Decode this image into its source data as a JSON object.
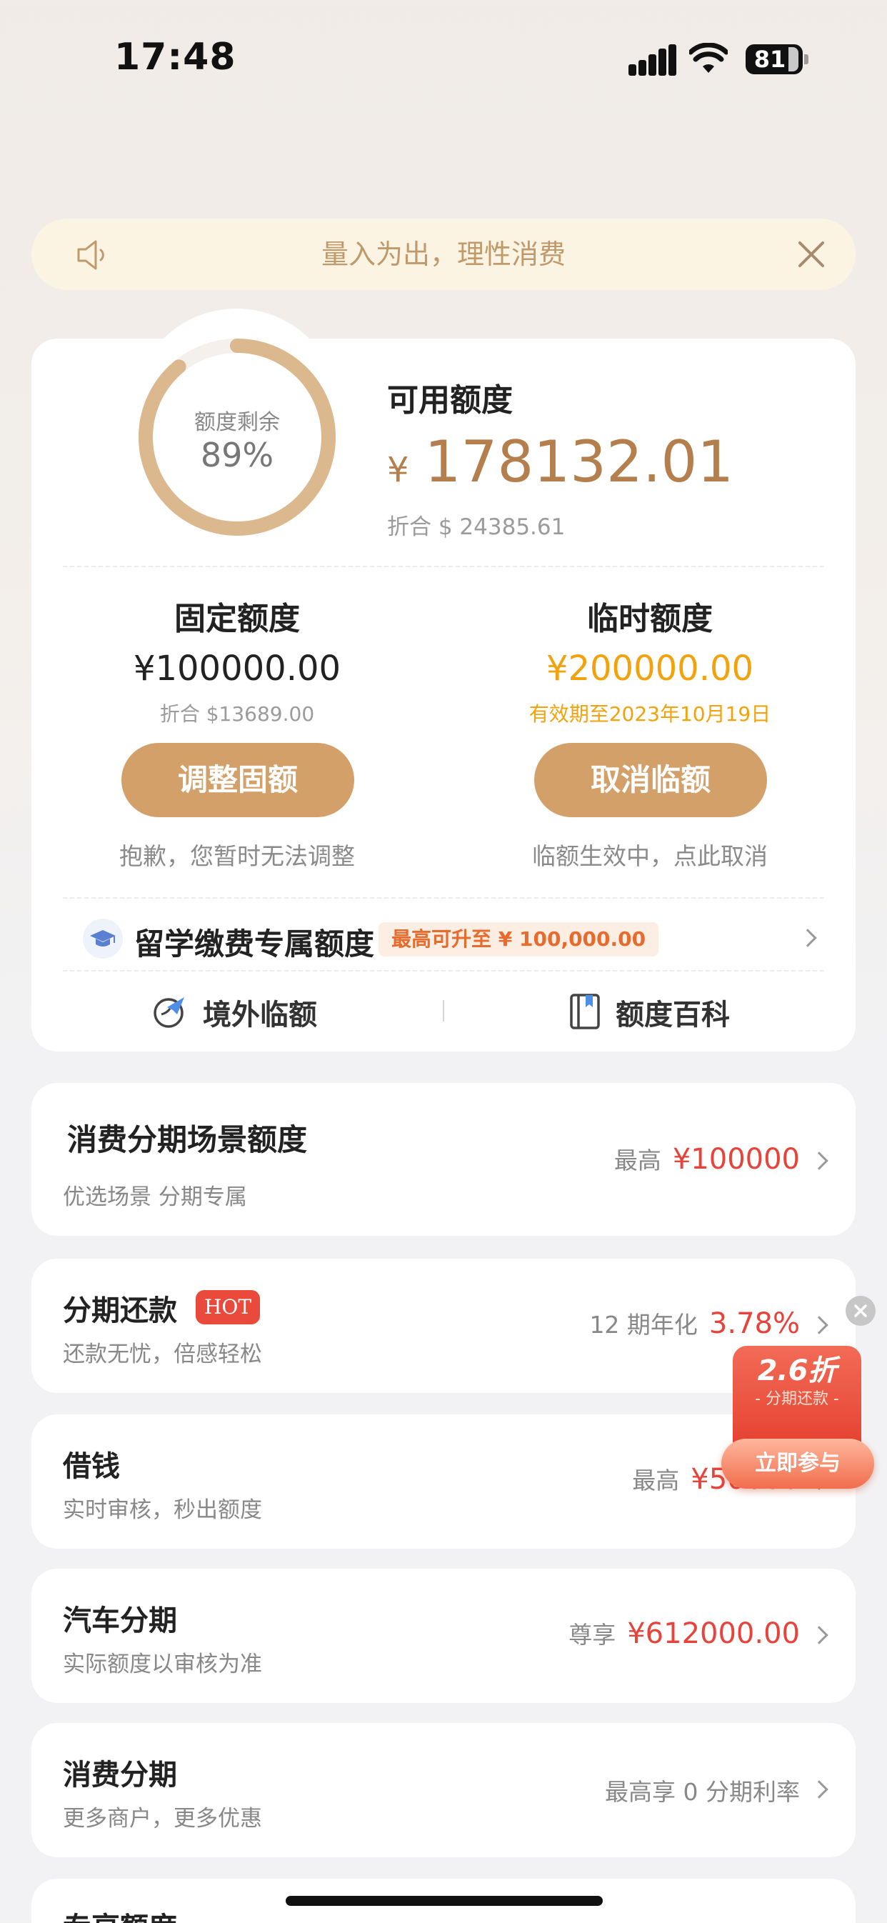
{
  "status_bar": {
    "time": "17:48",
    "battery": "81"
  },
  "notice": {
    "text": "量入为出，理性消费"
  },
  "credit": {
    "ring_label": "额度剩余",
    "ring_percent_text": "89%",
    "remaining_fraction": 0.89,
    "available_label": "可用额度",
    "available_currency": "¥",
    "available_amount": "178132.01",
    "available_usd": "折合 $ 24385.61",
    "fixed": {
      "title": "固定额度",
      "amount": "¥100000.00",
      "sub": "折合 $13689.00",
      "button": "调整固额",
      "note": "抱歉，您暂时无法调整"
    },
    "temp": {
      "title": "临时额度",
      "amount": "¥200000.00",
      "sub": "有效期至2023年10月19日",
      "button": "取消临额",
      "note": "临额生效中，点此取消"
    },
    "study": {
      "title": "留学缴费专属额度",
      "badge": "最高可升至 ¥ 100,000.00"
    },
    "links": {
      "overseas": "境外临额",
      "wiki": "额度百科"
    }
  },
  "scene": {
    "title": "消费分期场景额度",
    "sub": "优选场景 分期专属",
    "right_label": "最高",
    "right_value": "¥100000"
  },
  "items": [
    {
      "title": "分期还款",
      "badge": "HOT",
      "sub": "还款无忧，倍感轻松",
      "right_label": "12 期年化",
      "right_value": "3.78%"
    },
    {
      "title": "借钱",
      "sub": "实时审核，秒出额度",
      "right_label": "最高",
      "right_value": "¥50000"
    },
    {
      "title": "汽车分期",
      "sub": "实际额度以审核为准",
      "right_label": "尊享",
      "right_value": "¥612000.00"
    },
    {
      "title": "消费分期",
      "sub": "更多商户，更多优惠",
      "right_label": "最高享 0 分期利率",
      "right_value": ""
    },
    {
      "title": "专享额度",
      "sub": "",
      "right_label": "",
      "right_value": ""
    }
  ],
  "promo": {
    "discount": "2.6折",
    "sub": "- 分期还款 -",
    "button": "立即参与"
  },
  "colors": {
    "accent": "#d3a06a",
    "gold_text": "#b47f4c",
    "temp_amount": "#f2a20c",
    "red": "#e8433b"
  }
}
